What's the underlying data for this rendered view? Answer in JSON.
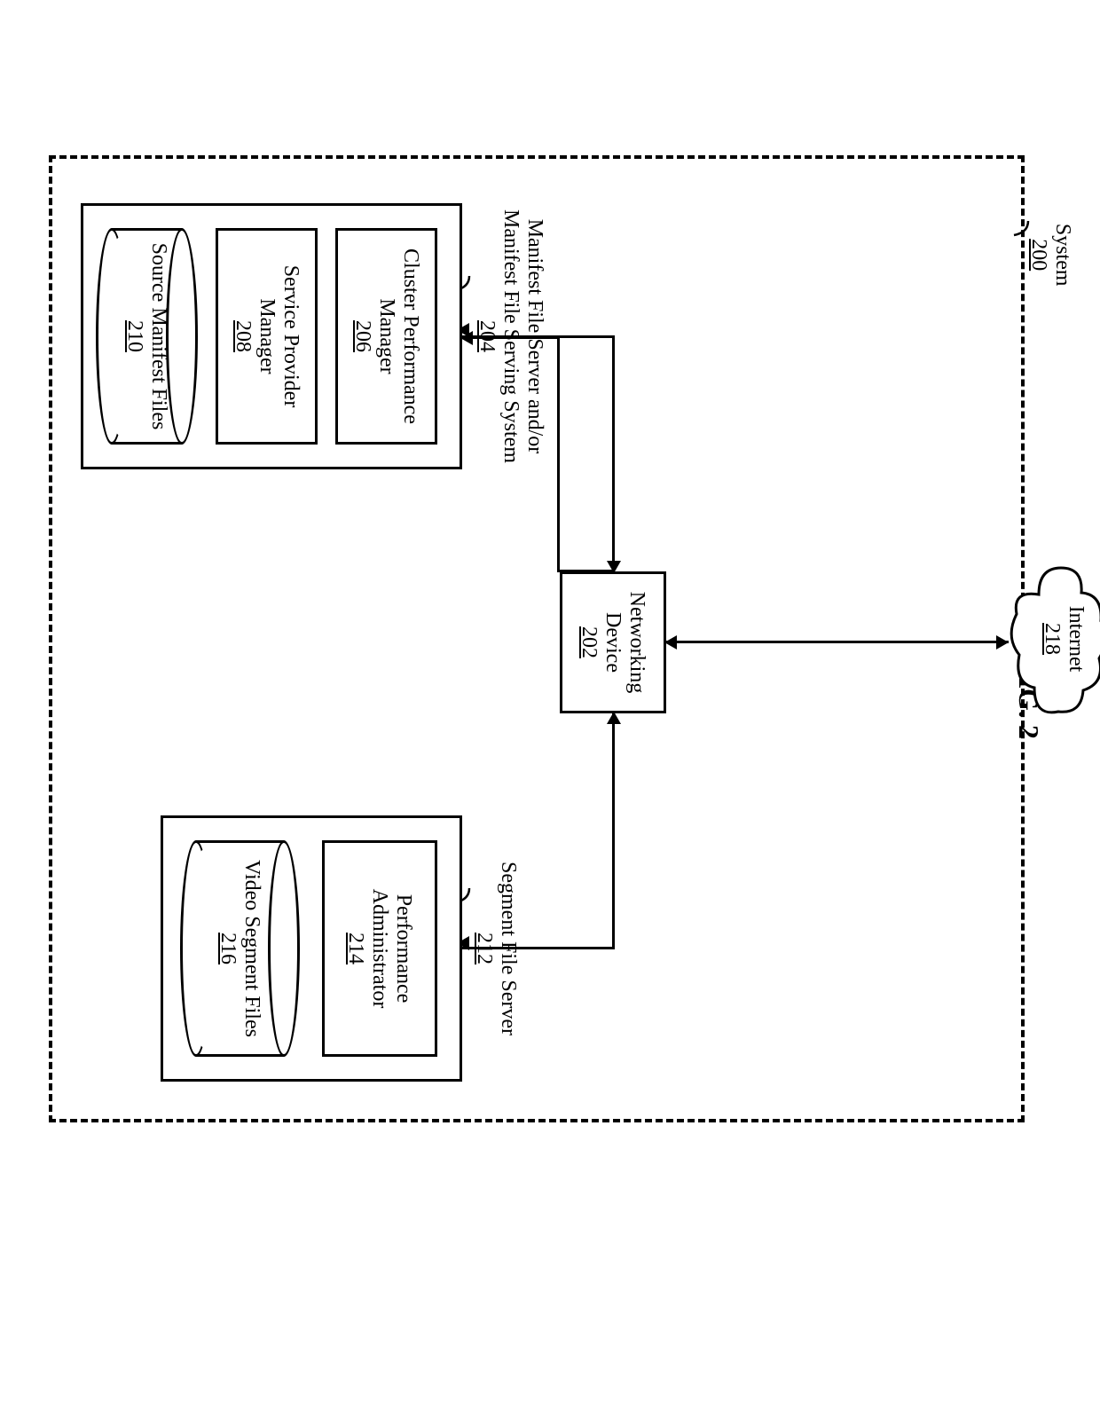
{
  "figure_label": "FIG. 2",
  "system": {
    "label": "System",
    "number": "200"
  },
  "cloud": {
    "label": "Internet",
    "number": "218"
  },
  "networking_device": {
    "label": "Networking Device",
    "number": "202"
  },
  "manifest_server": {
    "label": "Manifest File Server and/or Manifest File Serving System",
    "number": "204",
    "cluster_perf_manager": {
      "label": "Cluster Performance Manager",
      "number": "206"
    },
    "service_provider_manager": {
      "label": "Service Provider Manager",
      "number": "208"
    },
    "source_manifest_files": {
      "label": "Source Manifest Files",
      "number": "210"
    }
  },
  "segment_server": {
    "label": "Segment File Server",
    "number": "212",
    "performance_admin": {
      "label": "Performance Administrator",
      "number": "214"
    },
    "video_segment_files": {
      "label": "Video Segment Files",
      "number": "216"
    }
  }
}
